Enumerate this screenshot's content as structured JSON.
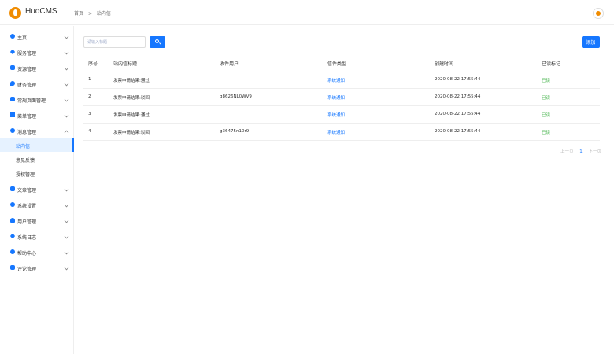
{
  "header": {
    "brand": "HuoCMS",
    "breadcrumb": [
      "首页",
      ">",
      "站内信"
    ]
  },
  "sidebar": {
    "items": [
      {
        "label": "主页",
        "icon": "dashboard-icon"
      },
      {
        "label": "服务管理",
        "icon": "service-icon"
      },
      {
        "label": "资源管理",
        "icon": "resource-icon"
      },
      {
        "label": "财务管理",
        "icon": "finance-icon"
      },
      {
        "label": "常规页面管理",
        "icon": "page-icon"
      },
      {
        "label": "菜单管理",
        "icon": "menu-icon"
      },
      {
        "label": "消息管理",
        "icon": "message-icon"
      },
      {
        "label": "文章管理",
        "icon": "article-icon"
      },
      {
        "label": "系统设置",
        "icon": "settings-icon"
      },
      {
        "label": "用户管理",
        "icon": "user-icon"
      },
      {
        "label": "系统日志",
        "icon": "log-icon"
      },
      {
        "label": "帮助中心",
        "icon": "help-icon"
      },
      {
        "label": "评论管理",
        "icon": "comment-icon"
      }
    ],
    "subitems": [
      {
        "label": "站内信"
      },
      {
        "label": "意见反馈"
      },
      {
        "label": "授权管理"
      }
    ]
  },
  "toolbar": {
    "search_placeholder": "请输入标题",
    "add_label": "添加"
  },
  "table": {
    "headers": [
      "序号",
      "站内信标题",
      "收件用户",
      "信件类型",
      "创建时间",
      "已读标记"
    ],
    "rows": [
      [
        "1",
        "发票申请结果:通过",
        "",
        "系统通知",
        "2020-08-22 17:55:44",
        "已读"
      ],
      [
        "2",
        "发票申请结果:驳回",
        "g8626NL0WV9",
        "系统通知",
        "2020-08-22 17:55:44",
        "已读"
      ],
      [
        "3",
        "发票申请结果:通过",
        "",
        "系统通知",
        "2020-08-22 17:55:44",
        "已读"
      ],
      [
        "4",
        "发票申请结果:驳回",
        "g36475n10r9",
        "系统通知",
        "2020-08-22 17:55:44",
        "已读"
      ]
    ]
  },
  "pagination": {
    "prev": "上一页",
    "current": "1",
    "next": "下一页"
  },
  "colors": {
    "accent": "#1677ff",
    "brand": "#f08c00",
    "read": "#3cb043"
  }
}
